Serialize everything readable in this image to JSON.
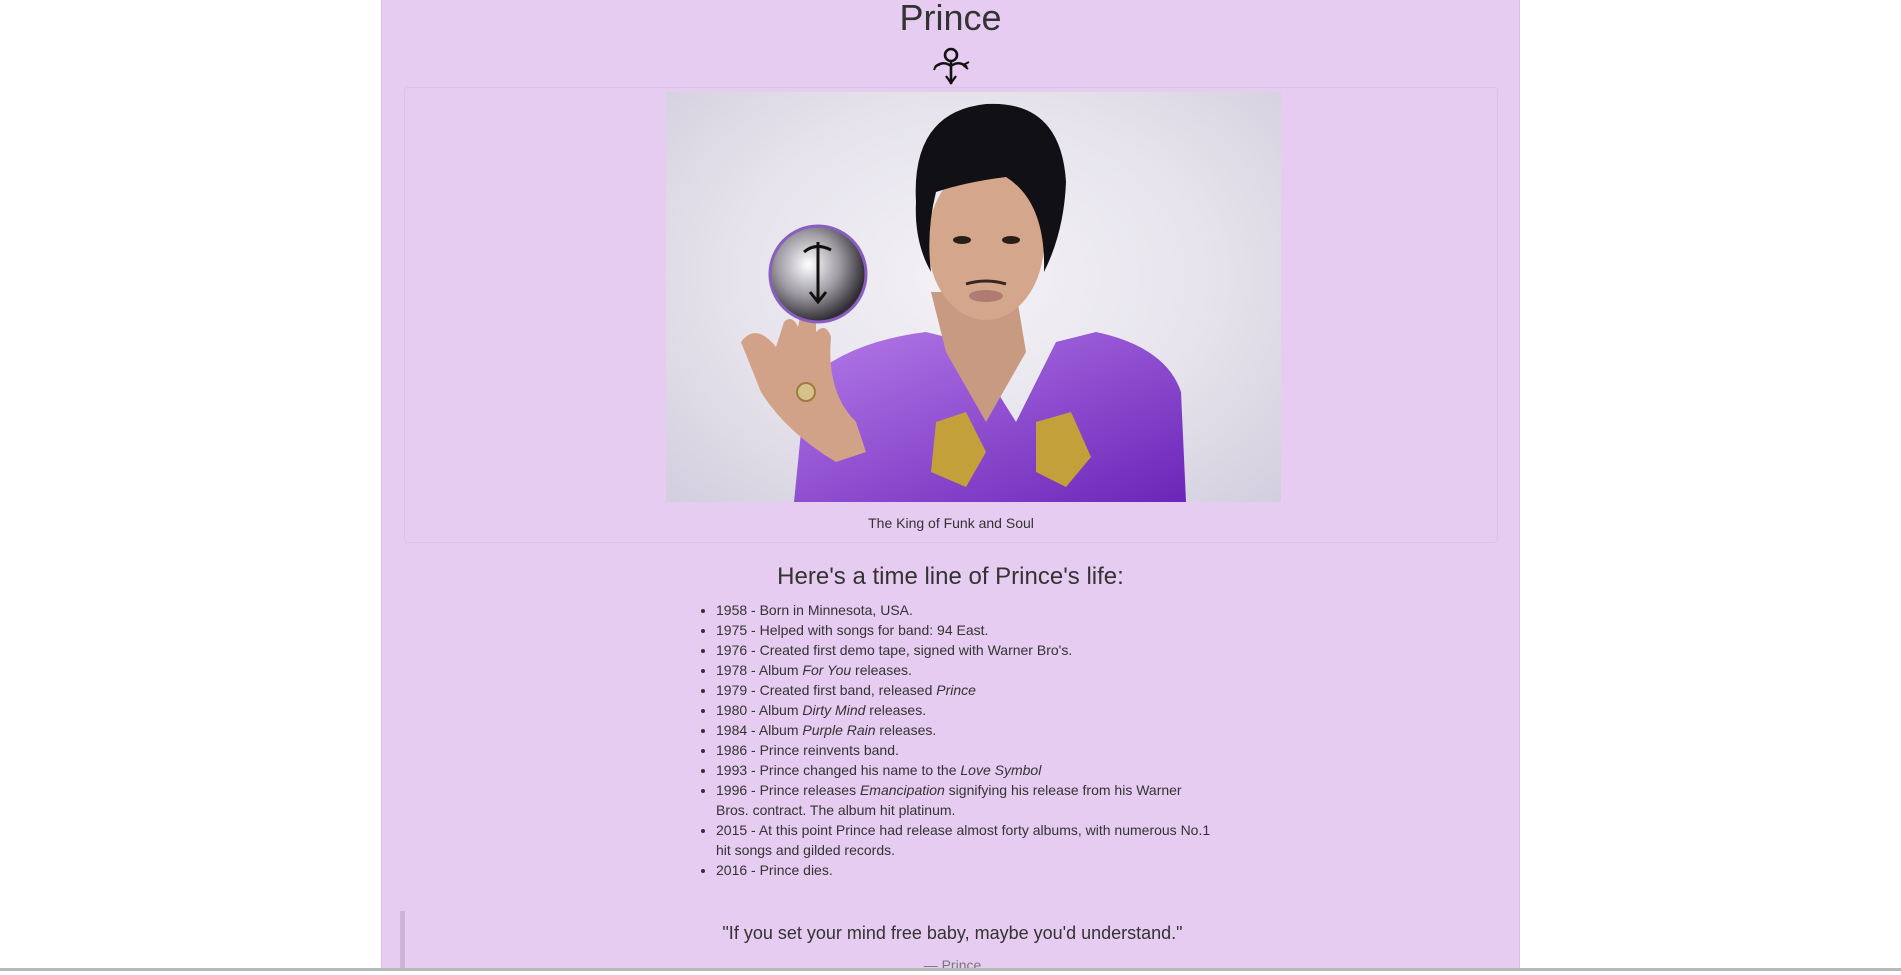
{
  "page": {
    "title": "Prince",
    "symbol_icon": "love-symbol-icon"
  },
  "photo": {
    "alt": "Prince holding a glass orb with the Love Symbol",
    "caption": "The King of Funk and Soul"
  },
  "timeline": {
    "heading": "Here's a time line of Prince's life:",
    "items": [
      {
        "before": "1958 - Born in Minnesota, USA.",
        "em": "",
        "after": ""
      },
      {
        "before": "1975 - Helped with songs for band: 94 East.",
        "em": "",
        "after": ""
      },
      {
        "before": "1976 - Created first demo tape, signed with Warner Bro's.",
        "em": "",
        "after": ""
      },
      {
        "before": "1978 - Album ",
        "em": "For You",
        "after": " releases."
      },
      {
        "before": "1979 - Created first band, released ",
        "em": "Prince",
        "after": ""
      },
      {
        "before": "1980 - Album ",
        "em": "Dirty Mind",
        "after": " releases."
      },
      {
        "before": "1984 - Album ",
        "em": "Purple Rain",
        "after": " releases."
      },
      {
        "before": "1986 - Prince reinvents band.",
        "em": "",
        "after": ""
      },
      {
        "before": "1993 - Prince changed his name to the ",
        "em": "Love Symbol",
        "after": ""
      },
      {
        "before": "1996 - Prince releases ",
        "em": "Emancipation",
        "after": " signifying his release from his Warner Bros. contract. The album hit platinum."
      },
      {
        "before": "2015 - At this point Prince had release almost forty albums, with numerous No.1 hit songs and gilded records.",
        "em": "",
        "after": ""
      },
      {
        "before": "2016 - Prince dies.",
        "em": "",
        "after": ""
      }
    ]
  },
  "quote": {
    "text": "\"If you set your mind free baby, maybe you'd understand.\"",
    "author": "— Prince"
  },
  "colors": {
    "page_background": "#e6ccf1",
    "outer_background": "#ffffff",
    "shirt_purple": "#8a3fd1"
  }
}
